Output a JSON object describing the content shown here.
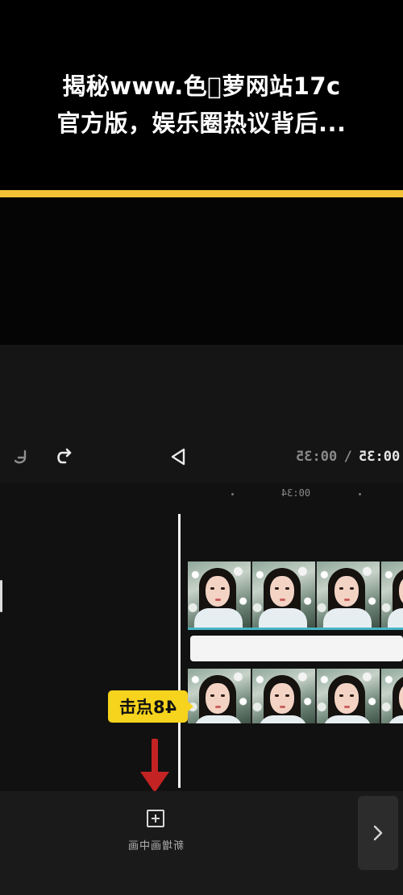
{
  "banner": {
    "title_line1": "揭秘www.色𫂂萝网站17c",
    "title_line2": "官方版，娱乐圈热议背后..."
  },
  "colors": {
    "accent_bar": "#f4c235",
    "callout_bg": "#f6d31c",
    "arrow": "#c32323",
    "track_line": "#47b5c6"
  },
  "toolbar": {
    "undo_icon": "undo-icon",
    "redo_icon": "redo-icon",
    "play_icon": "play-icon",
    "current_time": "00:35",
    "separator": "/",
    "total_time": "00:35"
  },
  "timeline": {
    "ruler_label": "00:34",
    "callout_text": "48点击"
  },
  "bottom_bar": {
    "pip_label": "新增画中画",
    "pip_icon": "add-square-icon",
    "next_icon": "chevron-right-icon"
  }
}
